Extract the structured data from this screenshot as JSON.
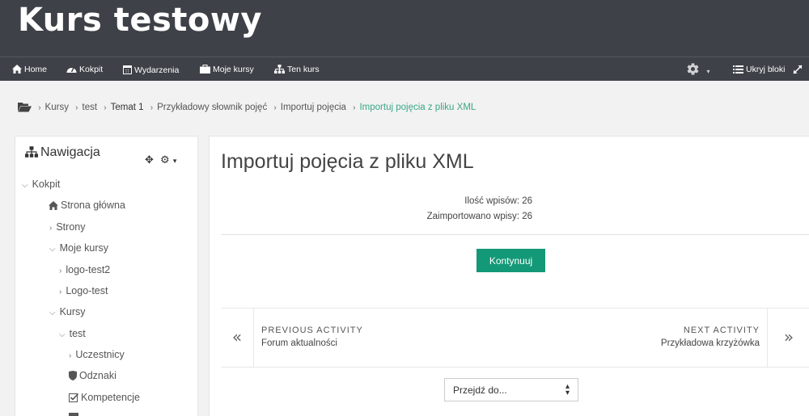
{
  "header": {
    "site_title": "Kurs testowy",
    "nav": [
      {
        "icon": "home-icon",
        "label": "Home"
      },
      {
        "icon": "dashboard-icon",
        "label": "Kokpit"
      },
      {
        "icon": "calendar-icon",
        "label": "Wydarzenia"
      },
      {
        "icon": "briefcase-icon",
        "label": "Moje kursy"
      },
      {
        "icon": "sitemap-icon",
        "label": "Ten kurs"
      }
    ],
    "hide_blocks_label": "Ukryj bloki"
  },
  "breadcrumb": [
    "Kursy",
    "test",
    "Temat 1",
    "Przykładowy słownik pojęć",
    "Importuj pojęcia",
    "Importuj pojęcia z pliku XML"
  ],
  "navigation_block": {
    "title": "Nawigacja",
    "items": [
      {
        "label": "Kokpit",
        "marker": "expanded"
      },
      {
        "label": "Strona główna",
        "marker": "home-icon"
      },
      {
        "label": "Strony",
        "marker": "collapsed"
      },
      {
        "label": "Moje kursy",
        "marker": "expanded"
      },
      {
        "label": "logo-test2",
        "marker": "collapsed"
      },
      {
        "label": "Logo-test",
        "marker": "collapsed"
      },
      {
        "label": "Kursy",
        "marker": "expanded"
      },
      {
        "label": "test",
        "marker": "expanded"
      },
      {
        "label": "Uczestnicy",
        "marker": "collapsed"
      },
      {
        "label": "Odznaki",
        "marker": "shield-icon"
      },
      {
        "label": "Kompetencje",
        "marker": "checkbox-icon"
      }
    ]
  },
  "main": {
    "heading": "Importuj pojęcia z pliku XML",
    "entries_count": "Ilość wpisów: 26",
    "imported_count": "Zaimportowano wpisy: 26",
    "continue_label": "Kontynuuj",
    "prev_label": "PREVIOUS ACTIVITY",
    "prev_name": "Forum aktualności",
    "next_label": "NEXT ACTIVITY",
    "next_name": "Przykładowa krzyżówka",
    "jump_select_value": "Przejdź do..."
  },
  "colors": {
    "header_bg": "#3e4147",
    "accent_green": "#139977",
    "breadcrumb_active": "#3aa786"
  }
}
